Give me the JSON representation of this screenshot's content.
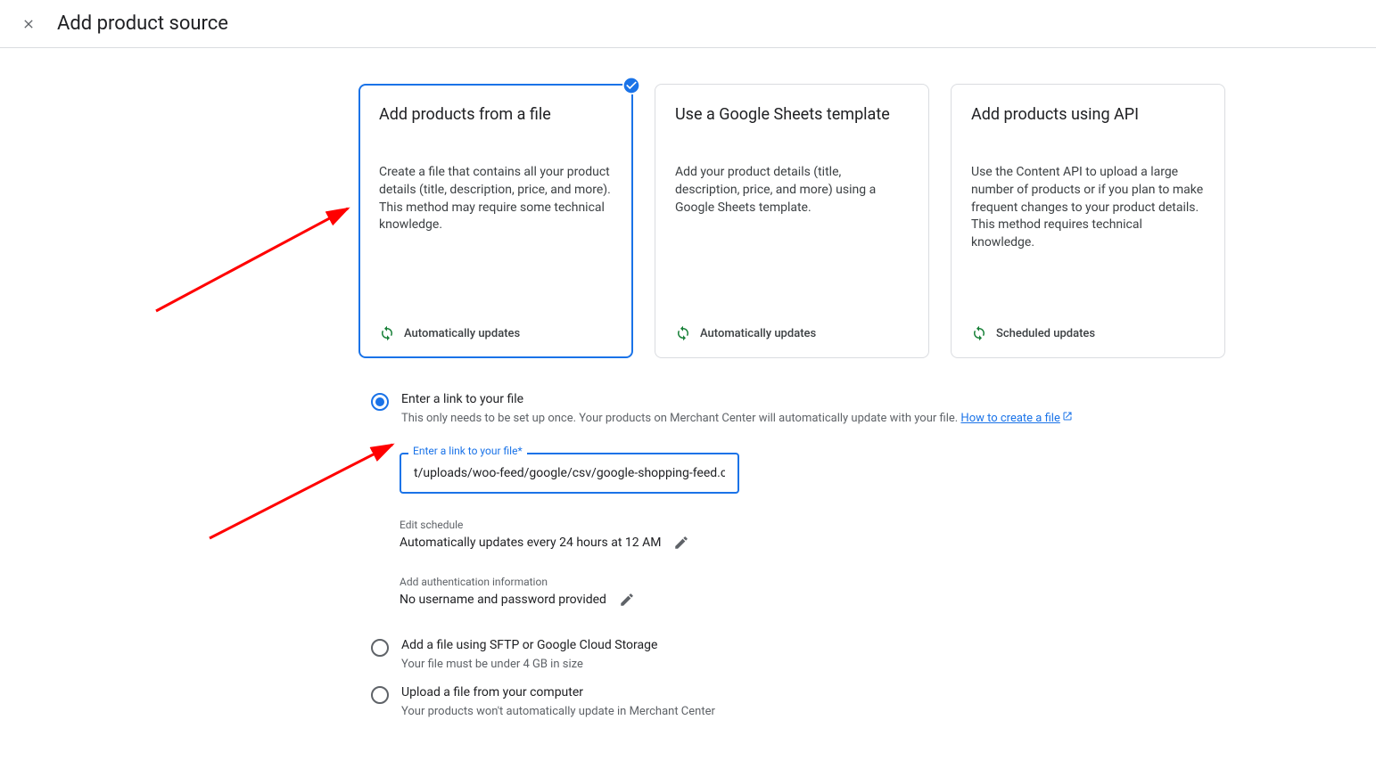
{
  "header": {
    "title": "Add product source"
  },
  "cards": [
    {
      "title": "Add products from a file",
      "description": "Create a file that contains all your product details (title, description, price, and more). This method may require some technical knowledge.",
      "footer": "Automatically updates",
      "selected": true
    },
    {
      "title": "Use a Google Sheets template",
      "description": "Add your product details (title, description, price, and more) using a Google Sheets template.",
      "footer": "Automatically updates",
      "selected": false
    },
    {
      "title": "Add products using API",
      "description": "Use the Content API to upload a large number of products or if you plan to make frequent changes to your product details. This method requires technical knowledge.",
      "footer": "Scheduled updates",
      "selected": false
    }
  ],
  "option_link": {
    "title": "Enter a link to your file",
    "subtitle_prefix": "This only needs to be set up once. Your products on Merchant Center will automatically update with your file. ",
    "link_text": "How to create a file"
  },
  "file_field": {
    "label": "Enter a link to your file*",
    "value": "t/uploads/woo-feed/google/csv/google-shopping-feed.csv"
  },
  "schedule": {
    "label": "Edit schedule",
    "value": "Automatically updates every 24 hours at 12 AM"
  },
  "auth": {
    "label": "Add authentication information",
    "value": "No username and password provided"
  },
  "option_sftp": {
    "title": "Add a file using SFTP or Google Cloud Storage",
    "subtitle": "Your file must be under 4 GB in size"
  },
  "option_upload": {
    "title": "Upload a file from your computer",
    "subtitle": "Your products won't automatically update in Merchant Center"
  }
}
